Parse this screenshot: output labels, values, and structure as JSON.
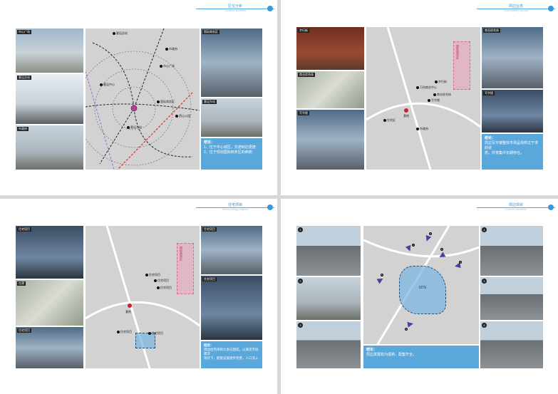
{
  "pages": [
    {
      "header": {
        "title": "区位分析",
        "subtitle": "Location analysis"
      },
      "page_number": "",
      "photos": [
        {
          "label": "市心广场"
        },
        {
          "label": "客运总站"
        },
        {
          "label": "市政府"
        },
        {
          "label": "国际商务区"
        },
        {
          "label": "客运东站"
        }
      ],
      "map_labels": [
        "客运总站",
        "市政府",
        "市心广场",
        "国际商务区",
        "客运东站",
        "客运中心",
        "西山公园",
        "地铁",
        "公园",
        "基地"
      ],
      "callout": {
        "heading": "结论：",
        "lines": [
          "1、位于中心城区，交通到达便捷",
          "2、位于规划国际商务区的西侧"
        ]
      }
    },
    {
      "header": {
        "title": "周边业态",
        "subtitle": "Surrounding format"
      },
      "page_number": "",
      "photos": [
        {
          "label": "步行街"
        },
        {
          "label": "商业综合体"
        },
        {
          "label": "写字楼"
        },
        {
          "label": "商业综合体"
        },
        {
          "label": "写字楼"
        }
      ],
      "map_labels": [
        "步行街",
        "商业综合体",
        "写字楼",
        "万科商业中心",
        "基地",
        "国际商务区",
        "住宅区",
        "市政府"
      ],
      "pink_zone": "国际商务区",
      "callout": {
        "heading": "结论：",
        "lines": [
          "周边写字楼整体市场呈现供过于求的状",
          "态，并将集中长期存在。"
        ]
      }
    },
    {
      "header": {
        "title": "住宅项目",
        "subtitle": "Surrounding projects"
      },
      "page_number": "",
      "photos": [
        {
          "label": "住宅项目"
        },
        {
          "label": "在建"
        },
        {
          "label": "住宅项目"
        },
        {
          "label": "住宅项目"
        },
        {
          "label": "住宅项目"
        }
      ],
      "map_labels": [
        "住宅项目",
        "住宅项目",
        "住宅项目",
        "基地",
        "住宅项目",
        "住宅项目"
      ],
      "pink_zone": "国际商务区",
      "callout": {
        "heading": "结论：",
        "lines": [
          "周边住宅项目大多已建成，以满足市场需求",
          "现状下，配套设施逐步完善，人口流入"
        ]
      }
    },
    {
      "header": {
        "title": "周边现状",
        "subtitle": "Current condition"
      },
      "page_number": "",
      "photos": [
        {
          "label": "1"
        },
        {
          "label": "2"
        },
        {
          "label": "3"
        },
        {
          "label": "4"
        },
        {
          "label": "5"
        },
        {
          "label": "6"
        }
      ],
      "map_labels": [
        "1",
        "2",
        "3",
        "4",
        "5",
        "6"
      ],
      "site_label": "SITE",
      "callout": {
        "heading": "结论：",
        "lines": [
          "周边发展较为成熟、配套齐全。"
        ]
      }
    }
  ],
  "footer": {
    "line1": "",
    "line2": ""
  }
}
